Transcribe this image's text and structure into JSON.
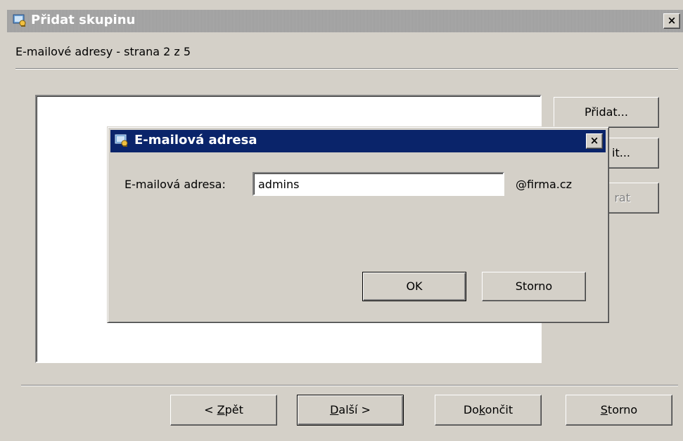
{
  "window": {
    "title": "Přidat skupinu",
    "close_label": "×",
    "subtitle": "E-mailové adresy - strana 2 z 5"
  },
  "side_buttons": {
    "add": "Přidat...",
    "edit_suffix": "it...",
    "remove_suffix": "rat"
  },
  "bottom_buttons": {
    "back_prefix": "< ",
    "back_key": "Z",
    "back_rest": "pět",
    "next_key": "D",
    "next_rest": "alší >",
    "finish_pre": "Do",
    "finish_key": "k",
    "finish_rest": "ončit",
    "cancel_key": "S",
    "cancel_rest": "torno"
  },
  "dialog": {
    "title": "E-mailová adresa",
    "close_label": "×",
    "field_label": "E-mailová adresa:",
    "field_value": "admins",
    "field_suffix": "@firma.cz",
    "ok_label": "OK",
    "cancel_label": "Storno"
  },
  "icons": {
    "window_icon": "group-window-icon",
    "dialog_icon": "group-window-icon"
  },
  "colors": {
    "face": "#d4d0c8",
    "active_title": "#0a246a",
    "inactive_title": "#a3a3a3"
  }
}
